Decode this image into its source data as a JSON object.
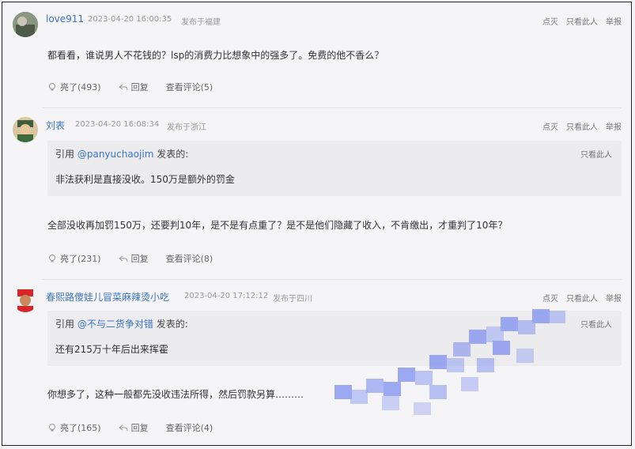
{
  "comments": [
    {
      "user": "love911",
      "time": "2023-04-20 16:00:35",
      "location": "发布于福建",
      "actions": [
        "点灭",
        "只看此人",
        "举报"
      ],
      "text": "都看看，谁说男人不花钱的？lsp的消费力比想象中的强多了。免费的他不香么？",
      "likes": "亮了(493)",
      "reply": "回复",
      "view_comments": "查看评论(5)"
    },
    {
      "user": "刘表",
      "time": "2023-04-20 16:08:34",
      "location": "发布于浙江",
      "actions": [
        "点灭",
        "只看此人",
        "举报"
      ],
      "quote": {
        "prefix": "引用",
        "quoted_user": "@panyuchaojim",
        "suffix": "发表的:",
        "only": "只看此人",
        "text": "非法获利是直接没收。150万是额外的罚金"
      },
      "text": "全部没收再加罚150万，还要判10年，是不是有点重了？是不是他们隐藏了收入，不肯缴出，才重判了10年？",
      "likes": "亮了(231)",
      "reply": "回复",
      "view_comments": "查看评论(8)"
    },
    {
      "user": "春熙路傻娃儿冒菜麻辣烫小吃",
      "time": "2023-04-20 17:12:12",
      "location": "发布于四川",
      "actions": [
        "点灭",
        "只看此人",
        "举报"
      ],
      "quote": {
        "prefix": "引用",
        "quoted_user": "@不与二货争对错",
        "suffix": "发表的:",
        "only": "只看此人",
        "text": "还有215万十年后出来挥霍"
      },
      "text": "你想多了，这种一般都先没收违法所得，然后罚款另算………",
      "likes": "亮了(165)",
      "reply": "回复",
      "view_comments": "查看评论(4)"
    }
  ],
  "colors": {
    "username": "#3b74c4",
    "meta": "#999999",
    "quote_bg": "#ececee",
    "mosaic": "#7f8ff0"
  }
}
